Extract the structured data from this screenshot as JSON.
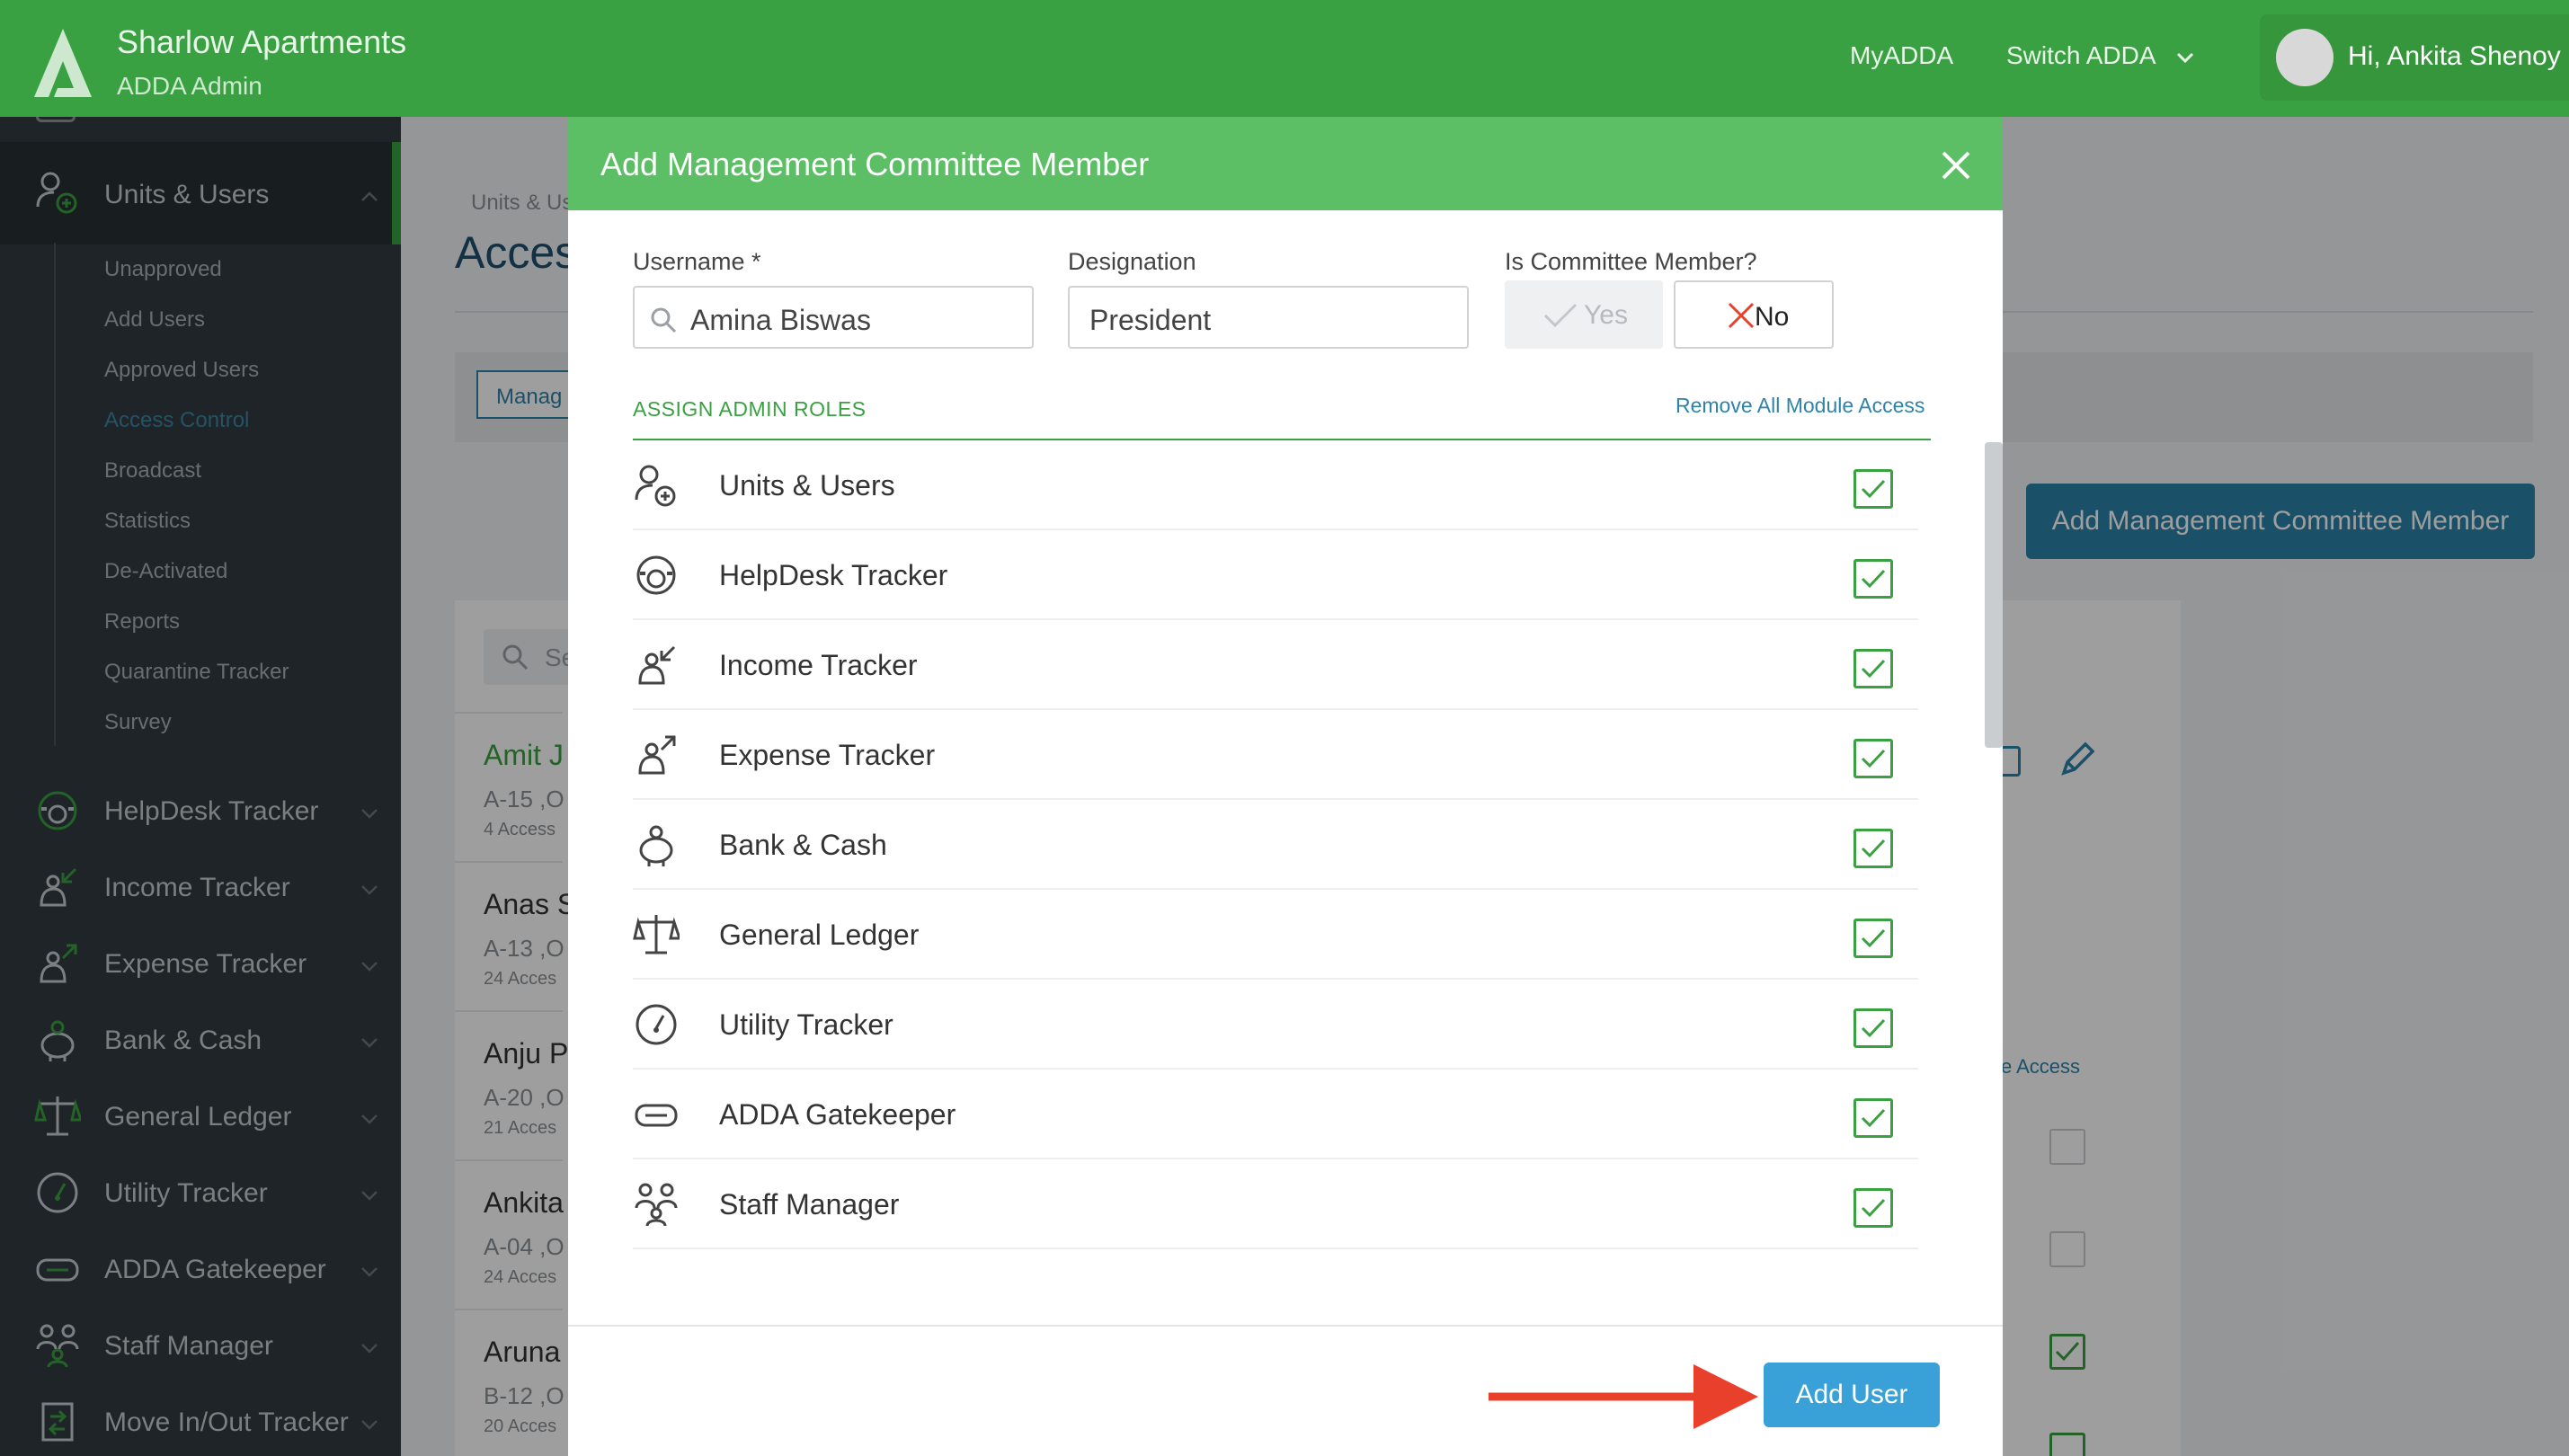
{
  "app": {
    "title": "Sharlow Apartments",
    "subtitle": "ADDA Admin",
    "nav": {
      "my_adda": "MyADDA",
      "switch_adda": "Switch ADDA"
    },
    "user_greeting": "Hi, Ankita Shenoy"
  },
  "sidebar": {
    "section": {
      "label": "Units & Users",
      "icon": "add-user-icon"
    },
    "sub_items": [
      {
        "label": "Unapproved"
      },
      {
        "label": "Add Users"
      },
      {
        "label": "Approved Users"
      },
      {
        "label": "Access Control",
        "active": true
      },
      {
        "label": "Broadcast"
      },
      {
        "label": "Statistics"
      },
      {
        "label": "De-Activated"
      },
      {
        "label": "Reports"
      },
      {
        "label": "Quarantine Tracker"
      },
      {
        "label": "Survey"
      }
    ],
    "items": [
      {
        "label": "HelpDesk Tracker",
        "icon": "helpdesk-icon"
      },
      {
        "label": "Income Tracker",
        "icon": "income-icon"
      },
      {
        "label": "Expense Tracker",
        "icon": "expense-icon"
      },
      {
        "label": "Bank & Cash",
        "icon": "piggy-bank-icon"
      },
      {
        "label": "General Ledger",
        "icon": "scales-icon"
      },
      {
        "label": "Utility Tracker",
        "icon": "gauge-icon"
      },
      {
        "label": "ADDA Gatekeeper",
        "icon": "gatekeeper-icon"
      },
      {
        "label": "Staff Manager",
        "icon": "staff-icon"
      },
      {
        "label": "Move In/Out Tracker",
        "icon": "move-icon"
      }
    ]
  },
  "background": {
    "breadcrumb": "Units & Us",
    "page_title": "Acces",
    "tab_label": "Manag",
    "add_button": "Add Management Committee Member",
    "search_placeholder": "Se",
    "rows": [
      {
        "name": "Amit J",
        "unit": "A-15 ,O",
        "access": "4 Access"
      },
      {
        "name": "Anas S",
        "unit": "A-13 ,O",
        "access": "24 Acces"
      },
      {
        "name": "Anju P",
        "unit": "A-20 ,O",
        "access": "21 Acces"
      },
      {
        "name": "Ankita",
        "unit": "A-04 ,O",
        "access": "24 Acces"
      },
      {
        "name": "Aruna",
        "unit": "B-12 ,O",
        "access": "20 Acces"
      }
    ],
    "right_access_label": "e Access"
  },
  "modal": {
    "title": "Add Management Committee Member",
    "username_label": "Username *",
    "username_value": "Amina Biswas",
    "designation_label": "Designation",
    "designation_value": "President",
    "committee_label": "Is Committee Member?",
    "yes_label": "Yes",
    "no_label": "No",
    "committee_selected": "No",
    "assign_title": "ASSIGN ADMIN ROLES",
    "remove_all": "Remove All Module Access",
    "modules": [
      {
        "label": "Units & Users",
        "icon": "add-user-icon",
        "checked": true
      },
      {
        "label": "HelpDesk Tracker",
        "icon": "helpdesk-icon",
        "checked": true
      },
      {
        "label": "Income Tracker",
        "icon": "income-icon",
        "checked": true
      },
      {
        "label": "Expense Tracker",
        "icon": "expense-icon",
        "checked": true
      },
      {
        "label": "Bank & Cash",
        "icon": "piggy-bank-icon",
        "checked": true
      },
      {
        "label": "General Ledger",
        "icon": "scales-icon",
        "checked": true
      },
      {
        "label": "Utility Tracker",
        "icon": "gauge-icon",
        "checked": true
      },
      {
        "label": "ADDA Gatekeeper",
        "icon": "gatekeeper-icon",
        "checked": true
      },
      {
        "label": "Staff Manager",
        "icon": "staff-icon",
        "checked": true
      }
    ],
    "submit_label": "Add User"
  },
  "colors": {
    "brand_green": "#3aa142",
    "modal_header": "#5cbf65",
    "link_blue": "#2d83a8",
    "button_blue": "#3aa1d8",
    "annotation_red": "#e8402a"
  }
}
